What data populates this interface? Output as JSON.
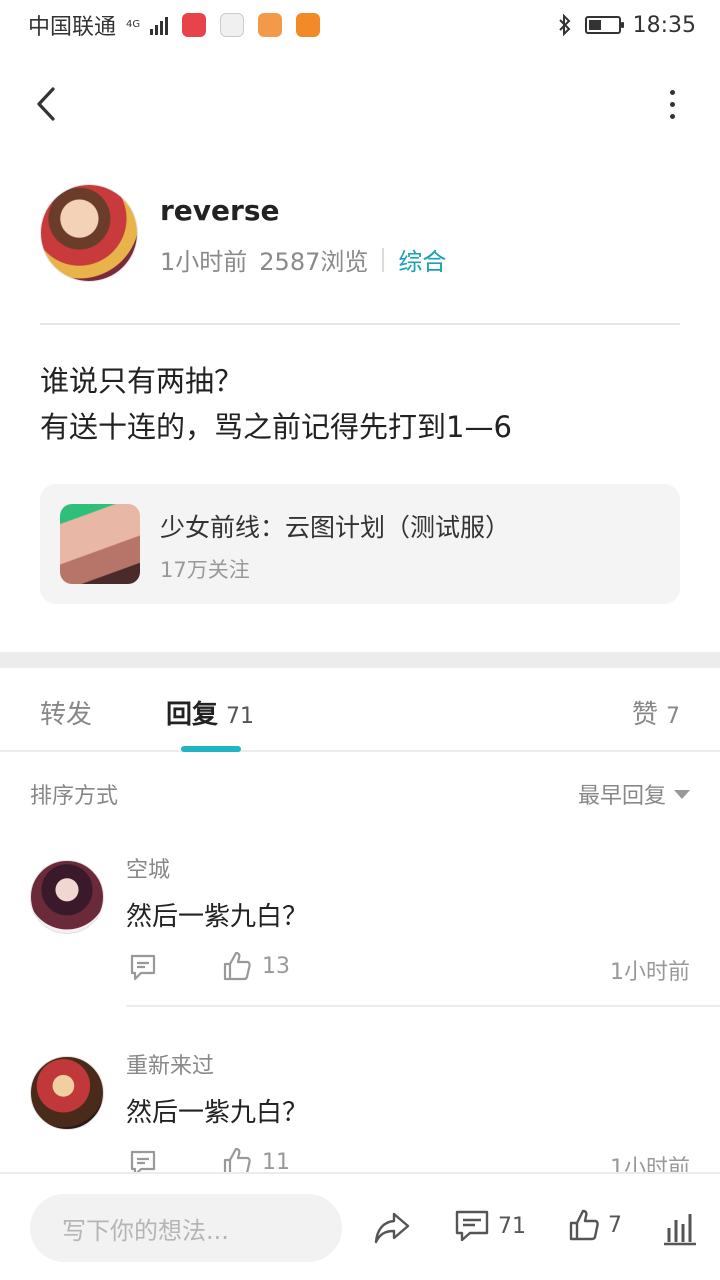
{
  "status_bar": {
    "carrier": "中国联通",
    "network": "4G",
    "time": "18:35"
  },
  "author": {
    "name": "reverse",
    "time_ago": "1小时前",
    "views": "2587浏览",
    "category": "综合"
  },
  "post": {
    "lines": [
      "谁说只有两抽？",
      "有送十连的，骂之前记得先打到1—6"
    ]
  },
  "game_card": {
    "title": "少女前线：云图计划（测试服）",
    "followers": "17万关注"
  },
  "tabs": {
    "repost_label": "转发",
    "reply_label": "回复",
    "reply_count": "71",
    "like_label": "赞",
    "like_count": "7"
  },
  "sort": {
    "label": "排序方式",
    "selected": "最早回复"
  },
  "comments": [
    {
      "user": "空城",
      "text": "然后一紫九白？",
      "likes": "13",
      "time": "1小时前"
    },
    {
      "user": "重新来过",
      "text": "然后一紫九白？",
      "likes": "11",
      "time": "1小时前"
    }
  ],
  "bottom_bar": {
    "input_placeholder": "写下你的想法...",
    "comment_count": "71",
    "like_count": "7"
  },
  "colors": {
    "accent": "#1fb5c4",
    "category": "#1aa3b4"
  }
}
